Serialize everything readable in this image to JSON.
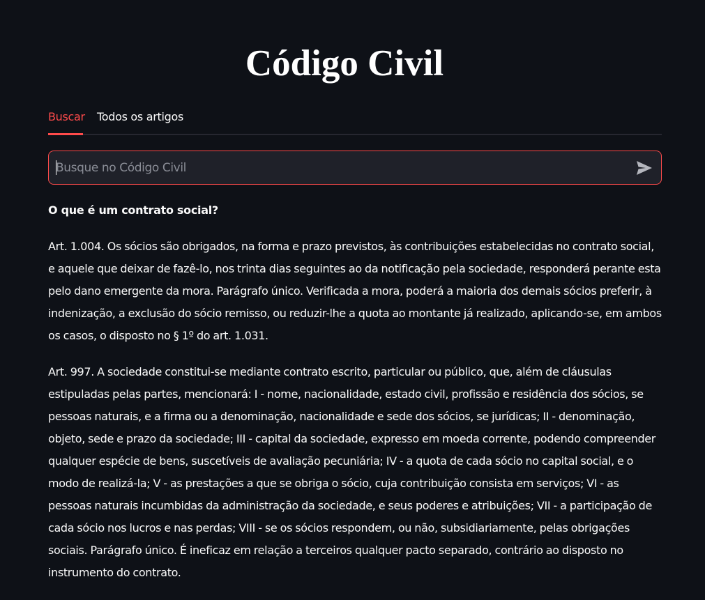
{
  "header": {
    "title": "Código Civil"
  },
  "tabs": [
    {
      "label": "Buscar",
      "active": true
    },
    {
      "label": "Todos os artigos",
      "active": false
    }
  ],
  "search": {
    "placeholder": "Busque no Código Civil",
    "value": "",
    "submit_icon": "send-icon"
  },
  "results": {
    "question": "O que é um contrato social?",
    "articles": [
      "Art. 1.004. Os sócios são obrigados, na forma e prazo previstos, às contribuições estabelecidas no contrato social, e aquele que deixar de fazê-lo, nos trinta dias seguintes ao da notificação pela sociedade, responderá perante esta pelo dano emergente da mora. Parágrafo único. Verificada a mora, poderá a maioria dos demais sócios preferir, à indenização, a exclusão do sócio remisso, ou reduzir-lhe a quota ao montante já realizado, aplicando-se, em ambos os casos, o disposto no § 1º do art. 1.031.",
      "Art. 997. A sociedade constitui-se mediante contrato escrito, particular ou público, que, além de cláusulas estipuladas pelas partes, mencionará: I - nome, nacionalidade, estado civil, profissão e residência dos sócios, se pessoas naturais, e a firma ou a denominação, nacionalidade e sede dos sócios, se jurídicas; II - denominação, objeto, sede e prazo da sociedade; III - capital da sociedade, expresso em moeda corrente, podendo compreender qualquer espécie de bens, suscetíveis de avaliação pecuniária; IV - a quota de cada sócio no capital social, e o modo de realizá-la; V - as prestações a que se obriga o sócio, cuja contribuição consista em serviços; VI - as pessoas naturais incumbidas da administração da sociedade, e seus poderes e atribuições; VII - a participação de cada sócio nos lucros e nas perdas; VIII - se os sócios respondem, ou não, subsidiariamente, pelas obrigações sociais. Parágrafo único. É ineficaz em relação a terceiros qualquer pacto separado, contrário ao disposto no instrumento do contrato."
    ]
  },
  "colors": {
    "background": "#0e1117",
    "accent": "#ff4b4b",
    "text": "#fafafa",
    "input_background": "#1f2129"
  }
}
